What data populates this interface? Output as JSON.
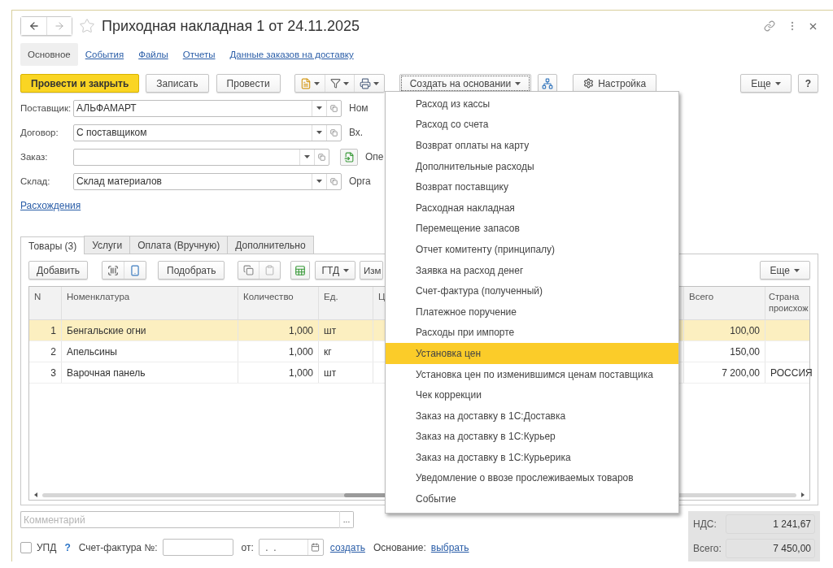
{
  "window": {
    "title": "Приходная накладная 1 от 24.11.2025"
  },
  "sections": [
    {
      "label": "Основное",
      "selected": true
    },
    {
      "label": "События",
      "selected": false
    },
    {
      "label": "Файлы",
      "selected": false
    },
    {
      "label": "Отчеты",
      "selected": false
    },
    {
      "label": "Данные заказов на доставку",
      "selected": false
    }
  ],
  "command_bar": {
    "post_and_close": "Провести и закрыть",
    "save": "Записать",
    "post": "Провести",
    "create_based_on": "Создать на основании",
    "settings": "Настройка",
    "more": "Еще",
    "help": "?"
  },
  "fields": [
    {
      "kind": "select",
      "label": "Поставщик:",
      "value": "АЛЬФАМАРТ",
      "side_label": "Ном"
    },
    {
      "kind": "select",
      "label": "Договор:",
      "value": "С поставщиком",
      "side_label": "Вх."
    },
    {
      "kind": "select_action",
      "label": "Заказ:",
      "side_label": "Опе"
    },
    {
      "kind": "select",
      "label": "Склад:",
      "value": "Склад материалов",
      "side_label": "Орга"
    }
  ],
  "discrepancies_link": "Расхождения",
  "tabs": [
    {
      "label": "Товары (3)",
      "selected": true
    },
    {
      "label": "Услуги",
      "selected": false
    },
    {
      "label": "Оплата (Вручную)",
      "selected": false
    },
    {
      "label": "Дополнительно",
      "selected": false
    }
  ],
  "table_toolbar": {
    "add": "Добавить",
    "pick": "Подобрать",
    "gtd": "ГТД",
    "change": "Изм",
    "more": "Еще"
  },
  "table": {
    "columns": [
      "N",
      "Номенклатура",
      "Количество",
      "Ед.",
      "Ц",
      "Всего",
      "Страна происхож"
    ],
    "rows": [
      {
        "selected": true,
        "cells": [
          "1",
          "Бенгальские огни",
          "1,000",
          "шт",
          "",
          "100,00",
          ""
        ]
      },
      {
        "selected": false,
        "cells": [
          "2",
          "Апельсины",
          "1,000",
          "кг",
          "",
          "150,00",
          ""
        ]
      },
      {
        "selected": false,
        "cells": [
          "3",
          "Варочная панель",
          "1,000",
          "шт",
          "",
          "7 200,00",
          "РОССИЯ"
        ]
      }
    ]
  },
  "comment": {
    "placeholder": "Комментарий",
    "button": "..."
  },
  "footer": {
    "upd_checked": false,
    "upd": "УПД",
    "help": "?",
    "invoice_label": "Счет-фактура №:",
    "from_label": "от:",
    "date_value": " .  . ",
    "create_link": "создать",
    "basis_label": "Основание:",
    "basis_link": "выбрать"
  },
  "totals": [
    {
      "label": "НДС:",
      "value": "1 241,67"
    },
    {
      "label": "Всего:",
      "value": "7 450,00"
    }
  ],
  "menu": {
    "items": [
      {
        "label": "Расход из кассы",
        "selected": false
      },
      {
        "label": "Расход со счета",
        "selected": false
      },
      {
        "label": "Возврат оплаты на карту",
        "selected": false
      },
      {
        "label": "Дополнительные расходы",
        "selected": false
      },
      {
        "label": "Возврат поставщику",
        "selected": false
      },
      {
        "label": "Расходная накладная",
        "selected": false
      },
      {
        "label": "Перемещение запасов",
        "selected": false
      },
      {
        "label": "Отчет комитенту (принципалу)",
        "selected": false
      },
      {
        "label": "Заявка на расход денег",
        "selected": false
      },
      {
        "label": "Счет-фактура (полученный)",
        "selected": false
      },
      {
        "label": "Платежное поручение",
        "selected": false
      },
      {
        "label": "Расходы при импорте",
        "selected": false
      },
      {
        "label": "Установка цен",
        "selected": true
      },
      {
        "label": "Установка цен по изменившимся ценам поставщика",
        "selected": false
      },
      {
        "label": "Чек коррекции",
        "selected": false
      },
      {
        "label": "Заказ на доставку в 1С:Доставка",
        "selected": false
      },
      {
        "label": "Заказ на доставку в 1С:Курьер",
        "selected": false
      },
      {
        "label": "Заказ на доставку в 1С:Курьерика",
        "selected": false
      },
      {
        "label": "Уведомление о ввозе прослеживаемых товаров",
        "selected": false
      },
      {
        "label": "Событие",
        "selected": false
      }
    ]
  }
}
